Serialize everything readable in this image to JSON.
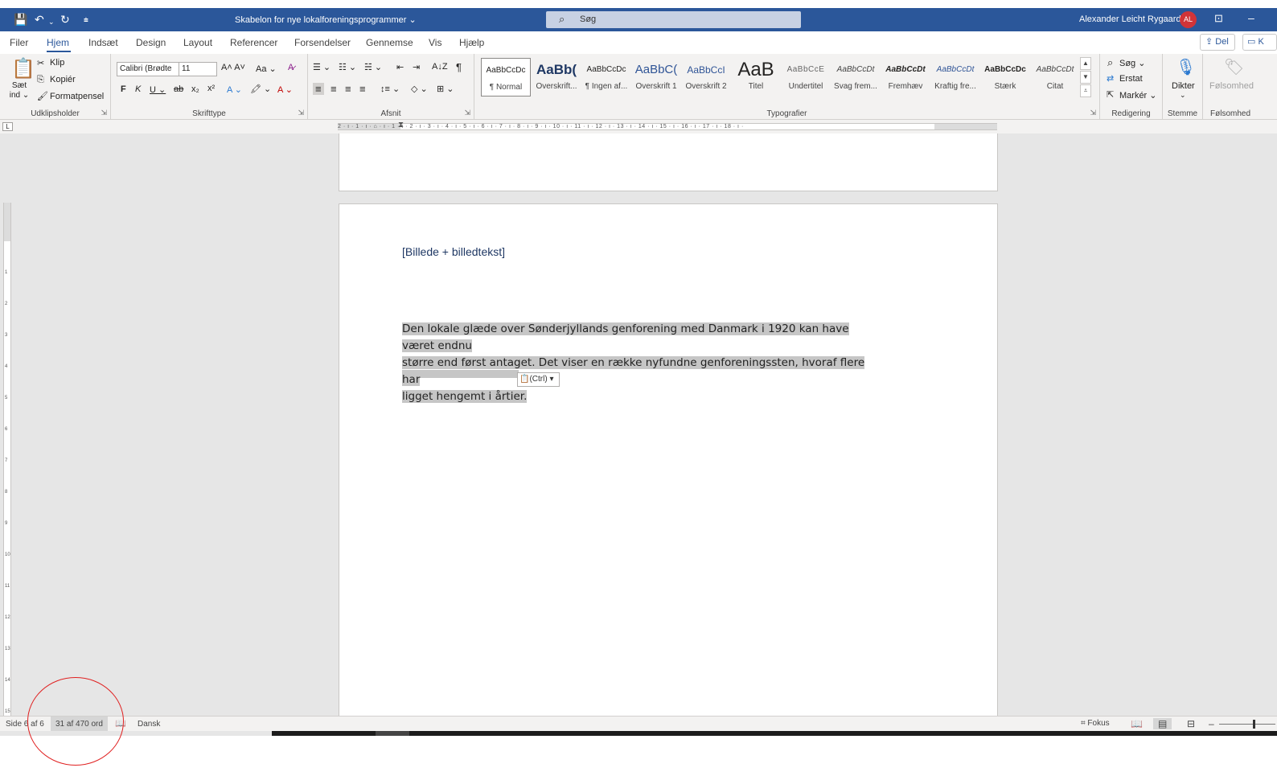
{
  "titlebar": {
    "save_icon": "💾",
    "undo_icon": "↶",
    "redo_icon": "↻",
    "customize_icon": "⩧",
    "doc_title": "Skabelon for nye lokalforeningsprogrammer ⌄",
    "search_placeholder": "Søg",
    "user_name": "Alexander Leicht Rygaard",
    "user_initials": "AL",
    "ribbon_display_icon": "⊡",
    "minimize_icon": "–"
  },
  "tabs": [
    "Filer",
    "Hjem",
    "Indsæt",
    "Design",
    "Layout",
    "Referencer",
    "Forsendelser",
    "Gennemse",
    "Vis",
    "Hjælp"
  ],
  "share_label": "⇪ Del",
  "comments_label": "▭ K",
  "ribbon": {
    "clipboard": {
      "paste_label": "Sæt ind ⌄",
      "cut_label": "Klip",
      "copy_label": "Kopiér",
      "format_painter_label": "Formatpensel",
      "group_label": "Udklipsholder"
    },
    "font": {
      "font_name": "Calibri (Brødte",
      "font_size": "11",
      "grow_label": "A˄ A˅",
      "case_label": "Aa ⌄",
      "clear_label": "A̷",
      "bold": "F",
      "italic": "K",
      "underline": "U ⌄",
      "strike": "ab",
      "subscript": "x₂",
      "superscript": "x²",
      "effects": "A ⌄",
      "highlight": "🖍 ⌄",
      "font_color": "A ⌄",
      "group_label": "Skrifttype"
    },
    "paragraph": {
      "bullets": "☰ ⌄",
      "numbering": "☷ ⌄",
      "multilevel": "☵ ⌄",
      "decrease_indent": "⇤",
      "increase_indent": "⇥",
      "sort": "A↓Z",
      "pilcrow": "¶",
      "align_left": "≡",
      "align_center": "≡",
      "align_right": "≡",
      "justify": "≡",
      "line_spacing": "↕≡ ⌄",
      "shading": "◇ ⌄",
      "borders": "⊞ ⌄",
      "group_label": "Afsnit"
    },
    "styles": {
      "items": [
        {
          "preview": "AaBbCcDc",
          "name": "¶ Normal"
        },
        {
          "preview": "AaBb(",
          "name": "Overskrift..."
        },
        {
          "preview": "AaBbCcDc",
          "name": "¶ Ingen af..."
        },
        {
          "preview": "AaBbC(",
          "name": "Overskrift 1"
        },
        {
          "preview": "AaBbCcI",
          "name": "Overskrift 2"
        },
        {
          "preview": "AaB",
          "name": "Titel"
        },
        {
          "preview": "AaBbCcE",
          "name": "Undertitel"
        },
        {
          "preview": "AaBbCcDt",
          "name": "Svag frem..."
        },
        {
          "preview": "AaBbCcDt",
          "name": "Fremhæv"
        },
        {
          "preview": "AaBbCcDt",
          "name": "Kraftig fre..."
        },
        {
          "preview": "AaBbCcDc",
          "name": "Stærk"
        },
        {
          "preview": "AaBbCcDt",
          "name": "Citat"
        }
      ],
      "group_label": "Typografier"
    },
    "editing": {
      "find": "Søg ⌄",
      "replace": "Erstat",
      "select": "Markér ⌄",
      "group_label": "Redigering"
    },
    "voice": {
      "dictate": "Dikter",
      "group_label": "Stemme"
    },
    "sensitivity": {
      "label": "Følsomhed",
      "group_label": "Følsomhed"
    }
  },
  "ruler": {
    "tab_selector": "L",
    "numbers": "2 · ı · 1 · ı · ⌂ · ı · 1 · ı · 2 · ı · 3 · ı · 4 · ı · 5 · ı · 6 · ı · 7 · ı · 8 · ı · 9 · ı · 10 · ı · 11 · ı · 12 · ı · 13 · ı · 14 · ı · 15 · ı · 16 · ı · 17 · ı · 18 · ı ·"
  },
  "document": {
    "placeholder": "[Billede + billedtekst]",
    "lines": [
      "Den lokale glæde over Sønderjyllands genforening med Danmark i 1920 kan have været endnu",
      "større end først antaget. Det viser en række nyfundne genforeningssten, hvoraf flere har",
      "ligget hengemt i årtier."
    ],
    "paste_options": "📋(Ctrl) ▾"
  },
  "status": {
    "page": "Side 6 af 6",
    "words": "31 af 470 ord",
    "proof_icon": "📖",
    "language": "Dansk",
    "focus": "Fokus",
    "focus_icon": "⌗",
    "read_mode_icon": "📖",
    "print_layout_icon": "▤",
    "web_layout_icon": "⊟",
    "zoom_minus": "–"
  },
  "colors": {
    "title_bar": "#2b579a",
    "accent": "#2b579a",
    "annotation": "#e02020",
    "selection": "#c6c6c6"
  }
}
